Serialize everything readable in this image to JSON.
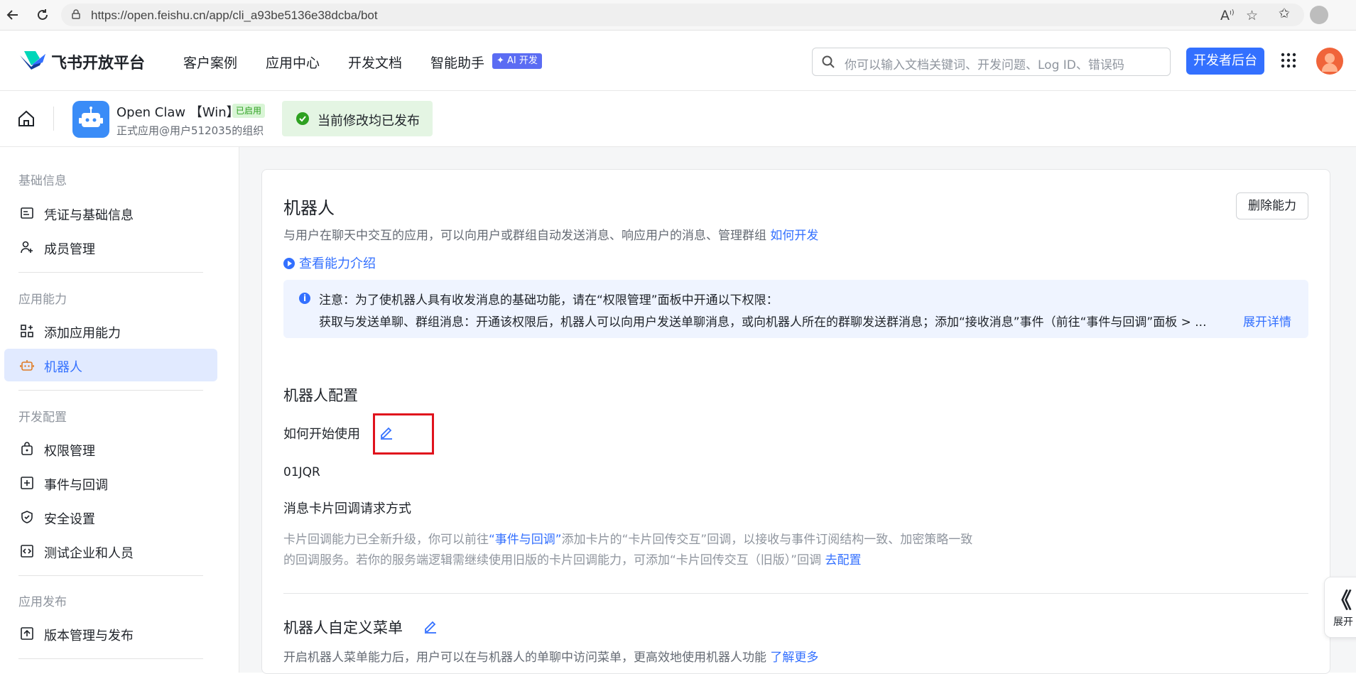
{
  "browser": {
    "url": "https://open.feishu.cn/app/cli_a93be5136e38dcba/bot"
  },
  "topnav": {
    "logo_text": "飞书开放平台",
    "items": [
      "客户案例",
      "应用中心",
      "开发文档",
      "智能助手"
    ],
    "ai_badge": "✦ AI 开发",
    "search_placeholder": "你可以输入文档关键词、开发问题、Log ID、错误码",
    "dev_console": "开发者后台"
  },
  "app": {
    "name": "Open Claw 【Win】",
    "status_badge": "已启用",
    "subtitle": "正式应用@用户512035的组织",
    "publish_status": "当前修改均已发布"
  },
  "sidebar": {
    "sections": [
      {
        "title": "基础信息",
        "items": [
          {
            "label": "凭证与基础信息",
            "icon": "credential-icon"
          },
          {
            "label": "成员管理",
            "icon": "member-add-icon"
          }
        ]
      },
      {
        "title": "应用能力",
        "items": [
          {
            "label": "添加应用能力",
            "icon": "add-grid-icon"
          },
          {
            "label": "机器人",
            "icon": "robot-icon"
          }
        ]
      },
      {
        "title": "开发配置",
        "items": [
          {
            "label": "权限管理",
            "icon": "lock-bag-icon"
          },
          {
            "label": "事件与回调",
            "icon": "event-icon"
          },
          {
            "label": "安全设置",
            "icon": "shield-icon"
          },
          {
            "label": "测试企业和人员",
            "icon": "test-code-icon"
          }
        ]
      },
      {
        "title": "应用发布",
        "items": [
          {
            "label": "版本管理与发布",
            "icon": "upload-icon"
          }
        ]
      }
    ],
    "active": "机器人"
  },
  "main": {
    "title": "机器人",
    "delete_button": "删除能力",
    "desc": "与用户在聊天中交互的应用，可以向用户或群组自动发送消息、响应用户的消息、管理群组",
    "desc_link": "如何开发",
    "intro_link": "查看能力介绍",
    "notice_line1": "注意：为了使机器人具有收发消息的基础功能，请在“权限管理”面板中开通以下权限：",
    "notice_line2": "获取与发送单聊、群组消息：开通该权限后，机器人可以向用户发送单聊消息，或向机器人所在的群聊发送群消息；添加“接收消息”事件（前往“事件与回调”面板 > ...",
    "notice_more": "展开详情",
    "config_title": "机器人配置",
    "how_to_start_label": "如何开始使用",
    "how_to_start_value": "01JQR",
    "card_callback_label": "消息卡片回调请求方式",
    "card_callback_p1a": "卡片回调能力已全新升级，你可以前往",
    "card_callback_p1_link": "“事件与回调”",
    "card_callback_p1b": "添加卡片的“卡片回传交互”回调，以接收与事件订阅结构一致、加密策略一致",
    "card_callback_p2": "的回调服务。若你的服务端逻辑需继续使用旧版的卡片回调能力，可添加“卡片回传交互（旧版）”回调",
    "card_callback_p2_link": "去配置",
    "menu_title": "机器人自定义菜单",
    "menu_desc": "开启机器人菜单能力后，用户可以在与机器人的单聊中访问菜单，更高效地使用机器人功能",
    "menu_link": "了解更多"
  },
  "expand_tab": {
    "chevron": "《",
    "label": "展开"
  },
  "colors": {
    "accent": "#3370ff",
    "highlight_box": "#e0121d",
    "success": "#2ea121"
  }
}
